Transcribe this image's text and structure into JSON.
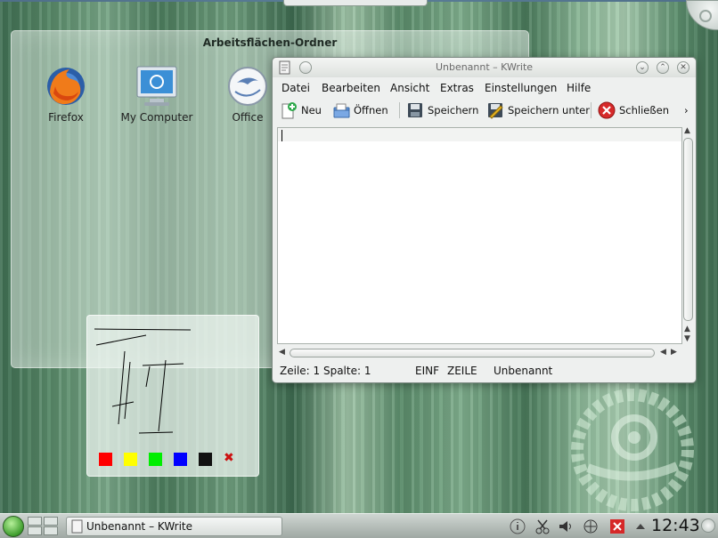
{
  "desktop": {
    "folder_title": "Arbeitsflächen-Ordner",
    "icons": [
      {
        "label": "Firefox",
        "icon": "firefox-icon"
      },
      {
        "label": "My Computer",
        "icon": "computer-icon"
      },
      {
        "label": "Office",
        "icon": "office-icon"
      }
    ]
  },
  "kwrite": {
    "title": "Unbenannt – KWrite",
    "menu": [
      "Datei",
      "Bearbeiten",
      "Ansicht",
      "Extras",
      "Einstellungen",
      "Hilfe"
    ],
    "toolbar": {
      "new": "Neu",
      "open": "Öffnen",
      "save": "Speichern",
      "save_as": "Speichern unter",
      "close": "Schließen",
      "more": "›"
    },
    "status": {
      "position": "Zeile: 1 Spalte: 1",
      "mode": "EINF",
      "selection": "ZEILE",
      "doc_name": "Unbenannt"
    }
  },
  "scribble": {
    "colors": [
      "#ff0000",
      "#ffff00",
      "#00ee00",
      "#0000ff",
      "#111111"
    ],
    "clear_symbol": "✖"
  },
  "taskbar": {
    "task_label": "Unbenannt – KWrite",
    "clock": "12:43",
    "tray": [
      "info-icon",
      "scissors-icon",
      "volume-icon",
      "network-icon",
      "close-red-icon",
      "arrow-up-icon"
    ]
  }
}
